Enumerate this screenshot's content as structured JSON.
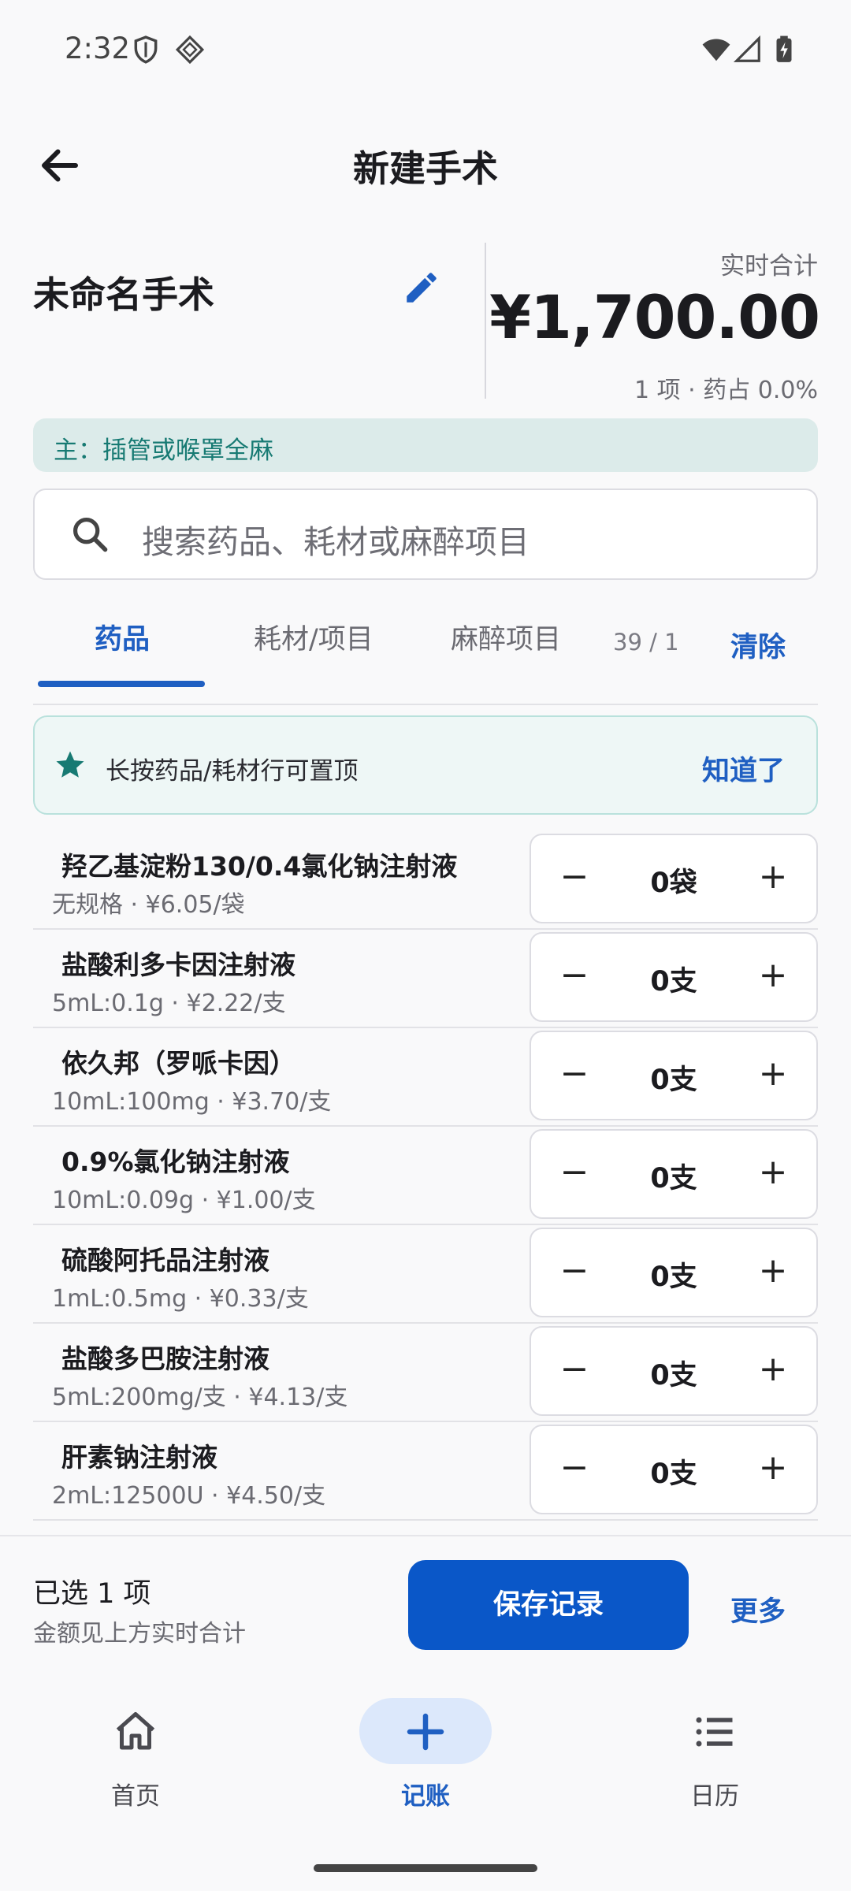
{
  "status": {
    "time": "2:32"
  },
  "header": {
    "title": "新建手术"
  },
  "summary": {
    "name": "未命名手术",
    "total_label": "实时合计",
    "total_amount": "¥1,700.00",
    "total_sub": "1 项 · 药占 0.0%",
    "main_chip": "主：插管或喉罩全麻"
  },
  "search": {
    "placeholder": "搜索药品、耗材或麻醉项目"
  },
  "tabs": [
    {
      "label": "药品"
    },
    {
      "label": "耗材/项目"
    },
    {
      "label": "麻醉项目"
    }
  ],
  "counter": "39 / 1",
  "clear_label": "清除",
  "tip": {
    "text": "长按药品/耗材行可置顶",
    "ok": "知道了"
  },
  "items": [
    {
      "name": "羟乙基淀粉130/0.4氯化钠注射液",
      "spec": "无规格 · ¥6.05/袋",
      "qty": "0袋"
    },
    {
      "name": "盐酸利多卡因注射液",
      "spec": "5mL:0.1g · ¥2.22/支",
      "qty": "0支"
    },
    {
      "name": "依久邦（罗哌卡因）",
      "spec": "10mL:100mg · ¥3.70/支",
      "qty": "0支"
    },
    {
      "name": "0.9%氯化钠注射液",
      "spec": "10mL:0.09g · ¥1.00/支",
      "qty": "0支"
    },
    {
      "name": "硫酸阿托品注射液",
      "spec": "1mL:0.5mg · ¥0.33/支",
      "qty": "0支"
    },
    {
      "name": "盐酸多巴胺注射液",
      "spec": "5mL:200mg/支 · ¥4.13/支",
      "qty": "0支"
    },
    {
      "name": "肝素钠注射液",
      "spec": "2mL:12500U · ¥4.50/支",
      "qty": "0支"
    }
  ],
  "stepper": {
    "minus": "−",
    "plus": "+"
  },
  "bottom": {
    "selected": "已选 1 项",
    "selected_sub": "金额见上方实时合计",
    "save": "保存记录",
    "more": "更多"
  },
  "nav": [
    {
      "label": "首页",
      "icon": "home-icon"
    },
    {
      "label": "记账",
      "icon": "plus-icon"
    },
    {
      "label": "日历",
      "icon": "list-icon"
    }
  ],
  "colors": {
    "accent": "#0a57c8",
    "teal": "#177a73"
  }
}
